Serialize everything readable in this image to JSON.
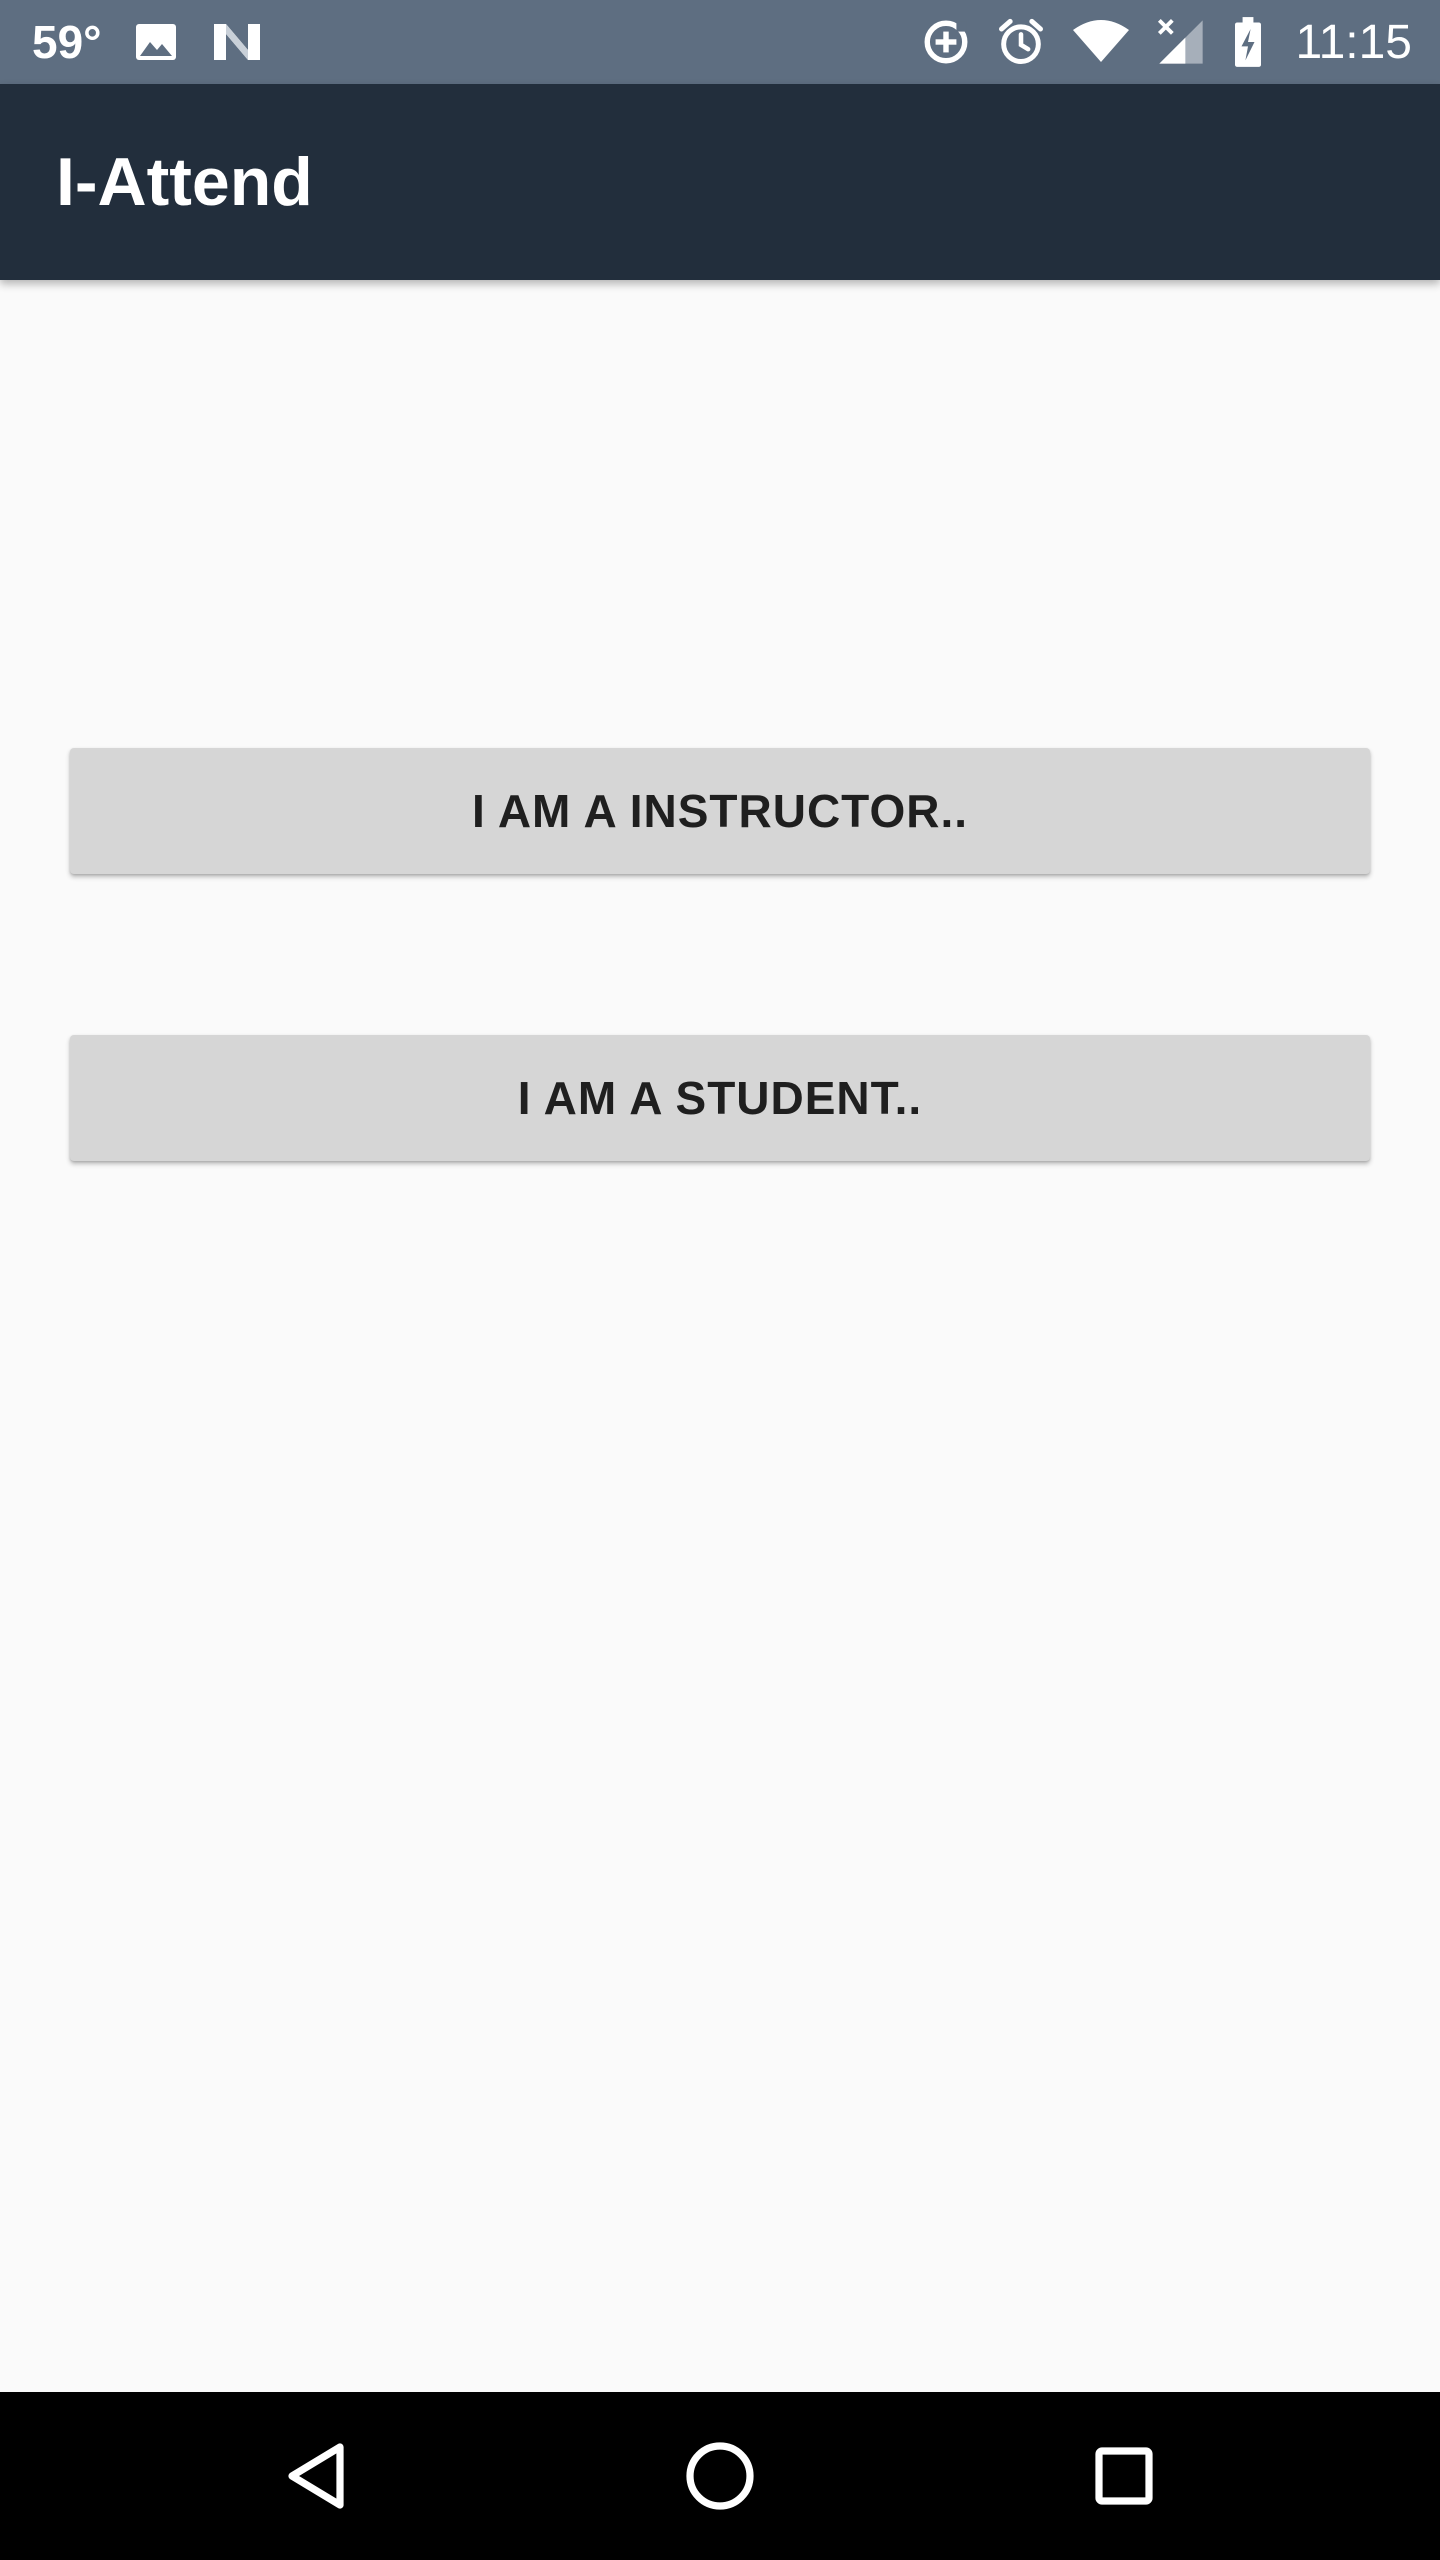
{
  "status_bar": {
    "temperature": "59°",
    "time": "11:15",
    "icons": [
      "image-icon",
      "n-logo-icon",
      "data-saver-icon",
      "alarm-icon",
      "wifi-icon",
      "cellular-no-signal-icon",
      "battery-charging-icon"
    ]
  },
  "app_bar": {
    "title": "I-Attend"
  },
  "main": {
    "instructor_button_label": "I AM A INSTRUCTOR..",
    "student_button_label": "I AM A STUDENT.."
  },
  "nav_bar": {
    "icons": [
      "back-icon",
      "home-icon",
      "recents-icon"
    ]
  },
  "colors": {
    "status_bar": "#5e6e81",
    "app_bar": "#222e3c",
    "background": "#fafafa",
    "button": "#d6d6d6",
    "button_text": "#1f1f1f",
    "nav_bar": "#000000"
  }
}
